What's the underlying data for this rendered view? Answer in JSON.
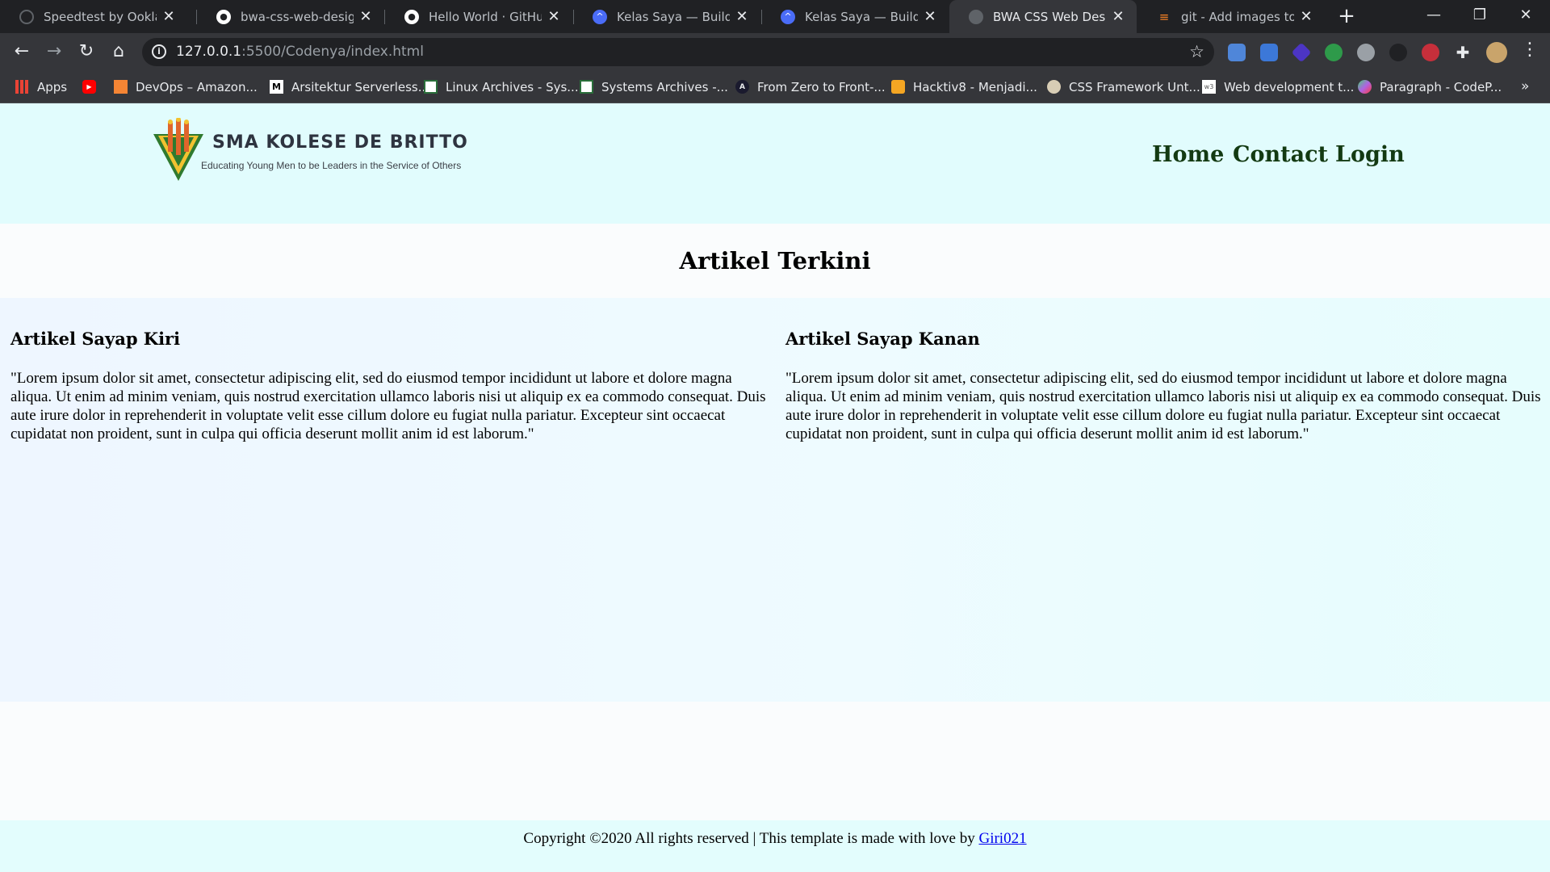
{
  "browser": {
    "tabs": [
      {
        "title": "Speedtest by Ookla - Th",
        "icon": "speedometer-icon",
        "color": "#5f6368"
      },
      {
        "title": "bwa-css-web-design/R",
        "icon": "github-icon",
        "color": "#ffffff"
      },
      {
        "title": "Hello World · GitHub G",
        "icon": "github-icon",
        "color": "#ffffff"
      },
      {
        "title": "Kelas Saya — BuildWith",
        "icon": "buildwith-icon",
        "color": "#4a6cf7"
      },
      {
        "title": "Kelas Saya — BuildWith",
        "icon": "buildwith-icon",
        "color": "#4a6cf7"
      },
      {
        "title": "BWA CSS Web Design |",
        "icon": "globe-icon",
        "color": "#9aa0a6"
      },
      {
        "title": "git - Add images to RE",
        "icon": "stackoverflow-icon",
        "color": "#f48024"
      }
    ],
    "active_tab": 5,
    "url_host": "127.0.0.1",
    "url_rest": ":5500/Codenya/index.html",
    "bookmarks": [
      {
        "label": "Apps",
        "icon": "apps-grid-icon"
      },
      {
        "label": "",
        "icon": "youtube-icon"
      },
      {
        "label": "DevOps – Amazon...",
        "icon": "aws-icon"
      },
      {
        "label": "Arsitektur Serverless...",
        "icon": "medium-icon"
      },
      {
        "label": "Linux Archives - Sys...",
        "icon": "site-icon"
      },
      {
        "label": "Systems Archives -...",
        "icon": "site-icon"
      },
      {
        "label": "From Zero to Front-...",
        "icon": "angular-icon"
      },
      {
        "label": "Hacktiv8 - Menjadi...",
        "icon": "hacktiv8-icon"
      },
      {
        "label": "CSS Framework Unt...",
        "icon": "skull-icon"
      },
      {
        "label": "Web development t...",
        "icon": "w3-icon"
      },
      {
        "label": "Paragraph - CodeP...",
        "icon": "codepen-icon"
      }
    ]
  },
  "site": {
    "logo_name": "SMA KOLESE DE BRITTO",
    "logo_tagline": "Educating Young Men to be Leaders in the Service of Others",
    "nav": [
      "Home",
      "Contact",
      "Login"
    ],
    "section_title": "Artikel Terkini",
    "articles": [
      {
        "title": "Artikel Sayap Kiri",
        "body": "\"Lorem ipsum dolor sit amet, consectetur adipiscing elit, sed do eiusmod tempor incididunt ut labore et dolore magna aliqua. Ut enim ad minim veniam, quis nostrud exercitation ullamco laboris nisi ut aliquip ex ea commodo consequat. Duis aute irure dolor in reprehenderit in voluptate velit esse cillum dolore eu fugiat nulla pariatur. Excepteur sint occaecat cupidatat non proident, sunt in culpa qui officia deserunt mollit anim id est laborum.\""
      },
      {
        "title": "Artikel Sayap Kanan",
        "body": "\"Lorem ipsum dolor sit amet, consectetur adipiscing elit, sed do eiusmod tempor incididunt ut labore et dolore magna aliqua. Ut enim ad minim veniam, quis nostrud exercitation ullamco laboris nisi ut aliquip ex ea commodo consequat. Duis aute irure dolor in reprehenderit in voluptate velit esse cillum dolore eu fugiat nulla pariatur. Excepteur sint occaecat cupidatat non proident, sunt in culpa qui officia deserunt mollit anim id est laborum.\""
      }
    ],
    "footer_text": "Copyright ©2020 All rights reserved | This template is made with love by ",
    "footer_link": "Giri021"
  },
  "colors": {
    "header_bg": "#e1fcfd",
    "nav_text": "#133a12",
    "link": "#0000ee"
  }
}
